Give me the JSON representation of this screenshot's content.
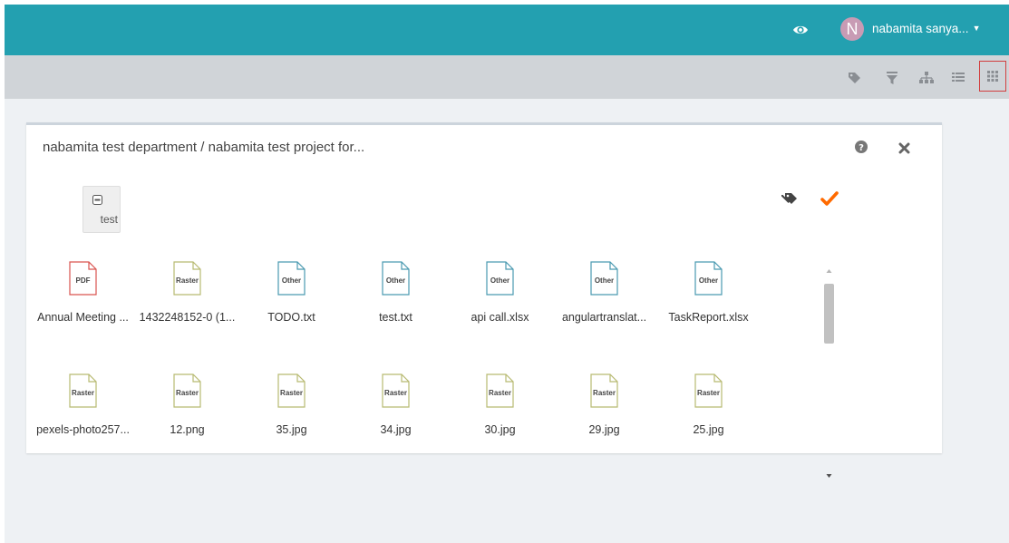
{
  "header": {
    "eye_icon": "eye-icon",
    "avatar_initial": "N",
    "avatar_color": "#c89bb4",
    "user_name": "nabamita sanya...",
    "brand_color": "#23a0b0"
  },
  "toolbar": {
    "icons": [
      "tag-icon",
      "filter-icon",
      "hierarchy-icon",
      "list-view-icon",
      "grid-view-icon"
    ],
    "active_view": "grid-view-icon"
  },
  "panel": {
    "breadcrumb": "nabamita test department / nabamita test project for...",
    "folder_label": "test",
    "accent_check_color": "#ff6a00"
  },
  "files": [
    {
      "type": "PDF",
      "name": "Annual Meeting ..."
    },
    {
      "type": "Raster",
      "name": "1432248152-0 (1..."
    },
    {
      "type": "Other",
      "name": "TODO.txt"
    },
    {
      "type": "Other",
      "name": "test.txt"
    },
    {
      "type": "Other",
      "name": "api call.xlsx"
    },
    {
      "type": "Other",
      "name": "angulartranslat..."
    },
    {
      "type": "Other",
      "name": "TaskReport.xlsx"
    },
    {
      "type": "Raster",
      "name": "pexels-photo257..."
    },
    {
      "type": "Raster",
      "name": "12.png"
    },
    {
      "type": "Raster",
      "name": "35.jpg"
    },
    {
      "type": "Raster",
      "name": "34.jpg"
    },
    {
      "type": "Raster",
      "name": "30.jpg"
    },
    {
      "type": "Raster",
      "name": "29.jpg"
    },
    {
      "type": "Raster",
      "name": "25.jpg"
    }
  ],
  "file_type_colors": {
    "PDF": "#d9534f",
    "Raster": "#b8ba72",
    "Other": "#4a9ab0"
  }
}
